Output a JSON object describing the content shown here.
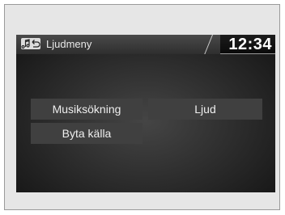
{
  "header": {
    "icon": "audio-return-icon",
    "title": "Ljudmeny",
    "clock": "12:34"
  },
  "menu": {
    "items": [
      {
        "label": "Musiksökning"
      },
      {
        "label": "Ljud"
      },
      {
        "label": "Byta källa"
      }
    ]
  },
  "colors": {
    "screen_bg": "#2a2a2a",
    "button_bg": "#404040",
    "text": "#eeeeee",
    "frame_bg": "#e6e6e6"
  }
}
